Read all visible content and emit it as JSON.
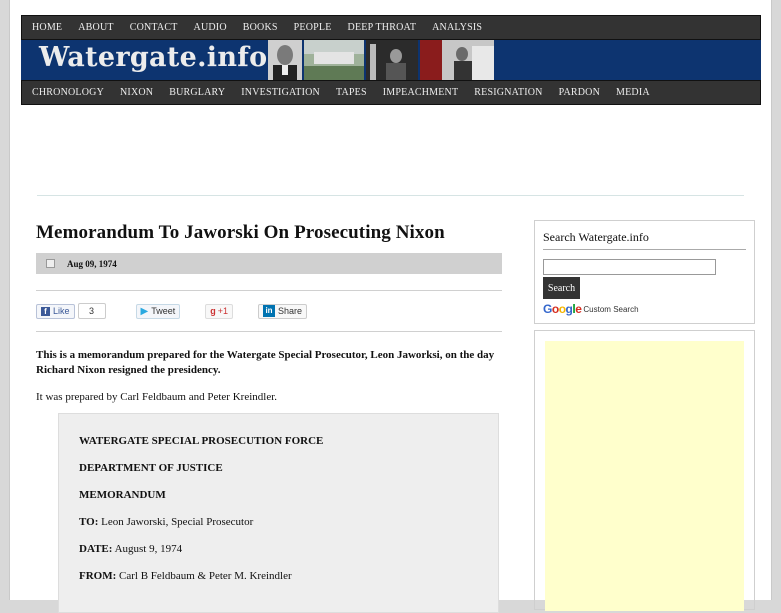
{
  "top_nav": [
    "HOME",
    "ABOUT",
    "CONTACT",
    "AUDIO",
    "BOOKS",
    "PEOPLE",
    "DEEP THROAT",
    "ANALYSIS"
  ],
  "site_title": "Watergate.info",
  "category_nav": [
    "CHRONOLOGY",
    "NIXON",
    "BURGLARY",
    "INVESTIGATION",
    "TAPES",
    "IMPEACHMENT",
    "RESIGNATION",
    "PARDON",
    "MEDIA"
  ],
  "article": {
    "title": "Memorandum To Jaworski On Prosecuting Nixon",
    "date": "Aug 09, 1974",
    "lead": "This is a memorandum prepared for the Watergate Special Prosecutor, Leon Jaworksi, on the day Richard Nixon resigned the presidency.",
    "intro": "It was prepared by Carl Feldbaum and Peter Kreindler."
  },
  "social": {
    "like_label": "Like",
    "like_count": "3",
    "tweet_label": "Tweet",
    "gplus_label": "+1",
    "share_label": "Share"
  },
  "memo": {
    "line1": "WATERGATE SPECIAL PROSECUTION FORCE",
    "line2": "DEPARTMENT OF JUSTICE",
    "line3": "MEMORANDUM",
    "to_label": "TO:",
    "to_value": "Leon Jaworski, Special Prosecutor",
    "date_label": "DATE:",
    "date_value": "August 9, 1974",
    "from_label": "FROM:",
    "from_value": "Carl B Feldbaum & Peter M. Kreindler"
  },
  "search": {
    "heading": "Search Watergate.info",
    "button": "Search",
    "custom_search": "Custom Search",
    "google_letters": [
      "G",
      "o",
      "o",
      "g",
      "l",
      "e"
    ]
  },
  "colors": {
    "nav_bg": "#333333",
    "banner_bg": "#0d3470",
    "ad_bg": "#ffffcc"
  }
}
